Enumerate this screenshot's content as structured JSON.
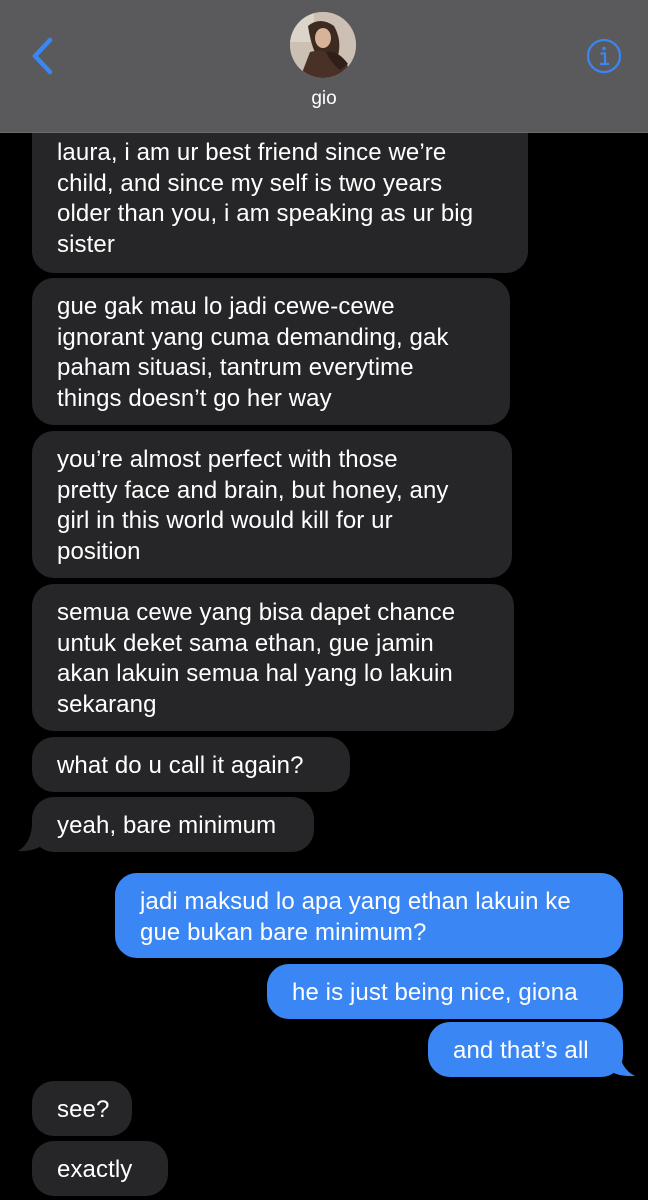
{
  "header": {
    "contact_name": "gio",
    "back_icon": "chevron-left-icon",
    "info_icon": "info-icon",
    "accent_color": "#3a86f5",
    "background_color": "#5a5a5c"
  },
  "colors": {
    "incoming_bubble": "#262628",
    "outgoing_bubble": "#3a86f5",
    "background": "#000000"
  },
  "messages": [
    {
      "from": "contact",
      "text": "laura, i am ur best friend since we’re\nchild, and since my self is two years\nolder than you, i am speaking as ur big\nsister"
    },
    {
      "from": "contact",
      "text": "gue gak mau lo jadi cewe-cewe\nignorant yang cuma demanding, gak\npaham situasi, tantrum everytime\nthings doesn’t go her way"
    },
    {
      "from": "contact",
      "text": "you’re almost perfect with those\npretty face and brain, but honey, any\ngirl in this world would kill for ur\nposition"
    },
    {
      "from": "contact",
      "text": "semua cewe yang bisa dapet chance\nuntuk deket sama ethan, gue jamin\nakan lakuin semua hal yang lo lakuin\nsekarang"
    },
    {
      "from": "contact",
      "text": "what do u call it again?"
    },
    {
      "from": "contact",
      "text": "yeah, bare minimum"
    },
    {
      "from": "me",
      "text": "jadi maksud lo apa yang ethan lakuin ke\ngue bukan bare minimum?"
    },
    {
      "from": "me",
      "text": "he is just being nice, giona"
    },
    {
      "from": "me",
      "text": "and that’s all"
    },
    {
      "from": "contact",
      "text": "see?"
    },
    {
      "from": "contact",
      "text": "exactly"
    }
  ]
}
